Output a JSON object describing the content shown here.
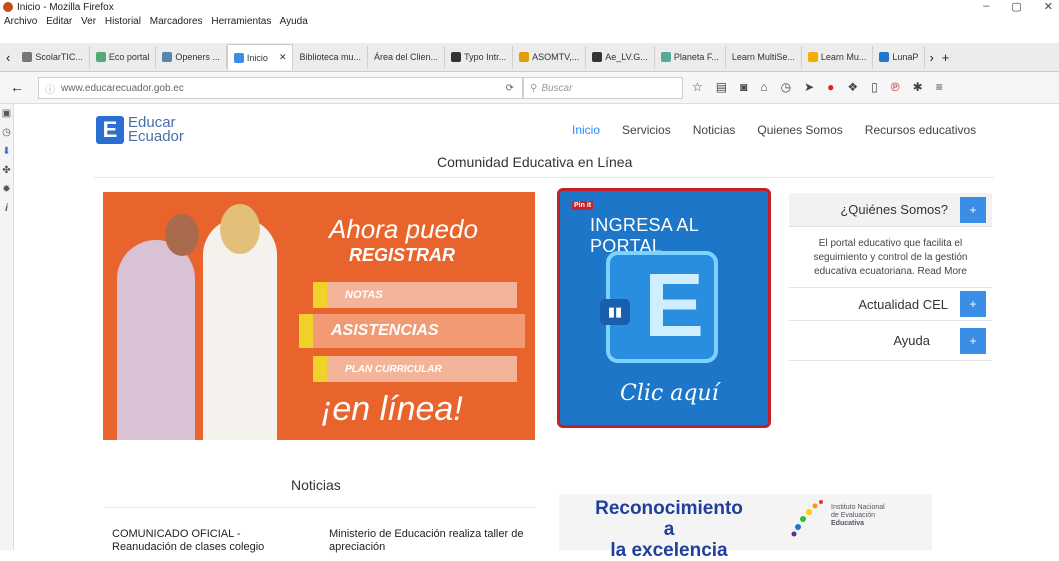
{
  "window": {
    "title": "Inicio - Mozilla Firefox",
    "controls": [
      "–",
      "▢",
      "✕"
    ]
  },
  "menu": [
    "Archivo",
    "Editar",
    "Ver",
    "Historial",
    "Marcadores",
    "Herramientas",
    "Ayuda"
  ],
  "tabs": [
    {
      "label": "ScolarTIC...",
      "color": "#777"
    },
    {
      "label": "Eco portal",
      "color": "#5a7"
    },
    {
      "label": "Openers ...",
      "color": "#58a"
    },
    {
      "label": "Inicio",
      "color": "#3a8ee6",
      "active": true
    },
    {
      "label": "Biblioteca mu...",
      "color": "#999"
    },
    {
      "label": "Área del Clien...",
      "color": "#999"
    },
    {
      "label": "Typo Intr...",
      "color": "#333"
    },
    {
      "label": "ASOMTV,...",
      "color": "#e0a000"
    },
    {
      "label": "Ae_LV.G...",
      "color": "#333"
    },
    {
      "label": "Planeta F...",
      "color": "#5a9"
    },
    {
      "label": "Learn MultiSe...",
      "color": "#999"
    },
    {
      "label": "Learn Mu...",
      "color": "#f0b000"
    },
    {
      "label": "LunaP",
      "color": "#27c"
    }
  ],
  "navbar": {
    "url": "www.educarecuador.gob.ec",
    "search_placeholder": "Buscar"
  },
  "site": {
    "logo_line1": "Educar",
    "logo_line2": "Ecuador",
    "nav": [
      "Inicio",
      "Servicios",
      "Noticias",
      "Quienes Somos",
      "Recursos educativos"
    ],
    "title": "Comunidad Educativa en Línea",
    "banner": {
      "line1": "Ahora puedo",
      "line2": "REGISTRAR",
      "items": [
        "NOTAS",
        "ASISTENCIAS",
        "PLAN CURRICULAR"
      ],
      "line3": "¡en línea!"
    },
    "portal": {
      "pin": "Pin it",
      "title": "INGRESA AL PORTAL",
      "cta": "Clic aquí"
    },
    "accordion": {
      "who_title": "¿Quiénes Somos?",
      "who_desc": "El portal educativo que facilita el seguimiento y control de la gestión educativa ecuatoriana. Read More",
      "cel": "Actualidad CEL",
      "help": "Ayuda",
      "plus": "+"
    },
    "news": {
      "heading": "Noticias",
      "item1": "COMUNICADO OFICIAL - Reanudación de clases colegio",
      "item2": "Ministerio de Educación realiza taller de apreciación"
    },
    "recognition": {
      "line1": "Reconocimiento a",
      "line2": "la excelencia",
      "institute": [
        "Instituto Nacional",
        "de Evaluación",
        "Educativa"
      ]
    }
  },
  "colors": {
    "accent": "#3a8ee6",
    "banner": "#e8642c",
    "portal": "#1d76c8",
    "frame": "#c3202a"
  }
}
